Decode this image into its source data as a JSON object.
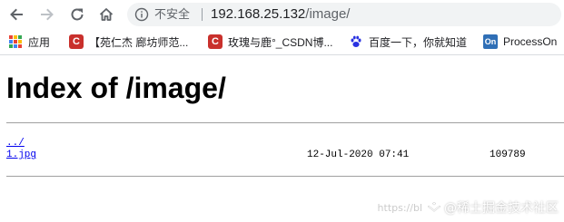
{
  "browser": {
    "address_bar": {
      "security_label": "不安全",
      "url_host": "192.168.25.132",
      "url_path": "/image/"
    },
    "bookmarks": [
      {
        "icon": "apps-grid-icon",
        "label": "应用"
      },
      {
        "icon": "csdn-favicon",
        "label": "【苑仁杰 廊坊师范..."
      },
      {
        "icon": "csdn-favicon",
        "label": "玫瑰与鹿°_CSDN博..."
      },
      {
        "icon": "baidu-paw-icon",
        "label": "百度一下，你就知道"
      },
      {
        "icon": "processon-favicon",
        "label": "ProcessOn"
      }
    ]
  },
  "page": {
    "title": "Index of /image/",
    "entries": [
      {
        "name": "../",
        "date": "",
        "size": ""
      },
      {
        "name": "1.jpg",
        "date": "12-Jul-2020 07:41",
        "size": "109789"
      }
    ]
  },
  "watermark": {
    "faint_text": "https://bl",
    "text": "@稀土掘金技术社区"
  },
  "colors": {
    "link": "#0000ee",
    "rule": "#a0a0a0",
    "omnibox_bg": "#f1f3f4",
    "csdn_red": "#c9302c",
    "baidu_blue": "#2932e1",
    "processon_blue": "#2f6fb6"
  }
}
